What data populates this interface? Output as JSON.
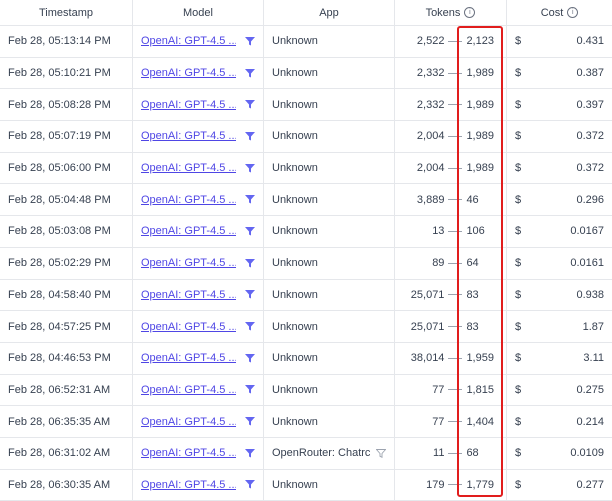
{
  "headers": {
    "timestamp": "Timestamp",
    "model": "Model",
    "app": "App",
    "tokens": "Tokens",
    "cost": "Cost"
  },
  "rows": [
    {
      "timestamp": "Feb 28, 05:13:14 PM",
      "model": "OpenAI: GPT-4.5 ...",
      "app": "Unknown",
      "tokens_in": "2,522",
      "tokens_out": "2,123",
      "currency": "$",
      "cost": "0.431"
    },
    {
      "timestamp": "Feb 28, 05:10:21 PM",
      "model": "OpenAI: GPT-4.5 ...",
      "app": "Unknown",
      "tokens_in": "2,332",
      "tokens_out": "1,989",
      "currency": "$",
      "cost": "0.387"
    },
    {
      "timestamp": "Feb 28, 05:08:28 PM",
      "model": "OpenAI: GPT-4.5 ...",
      "app": "Unknown",
      "tokens_in": "2,332",
      "tokens_out": "1,989",
      "currency": "$",
      "cost": "0.397"
    },
    {
      "timestamp": "Feb 28, 05:07:19 PM",
      "model": "OpenAI: GPT-4.5 ...",
      "app": "Unknown",
      "tokens_in": "2,004",
      "tokens_out": "1,989",
      "currency": "$",
      "cost": "0.372"
    },
    {
      "timestamp": "Feb 28, 05:06:00 PM",
      "model": "OpenAI: GPT-4.5 ...",
      "app": "Unknown",
      "tokens_in": "2,004",
      "tokens_out": "1,989",
      "currency": "$",
      "cost": "0.372"
    },
    {
      "timestamp": "Feb 28, 05:04:48 PM",
      "model": "OpenAI: GPT-4.5 ...",
      "app": "Unknown",
      "tokens_in": "3,889",
      "tokens_out": "46",
      "currency": "$",
      "cost": "0.296"
    },
    {
      "timestamp": "Feb 28, 05:03:08 PM",
      "model": "OpenAI: GPT-4.5 ...",
      "app": "Unknown",
      "tokens_in": "13",
      "tokens_out": "106",
      "currency": "$",
      "cost": "0.0167"
    },
    {
      "timestamp": "Feb 28, 05:02:29 PM",
      "model": "OpenAI: GPT-4.5 ...",
      "app": "Unknown",
      "tokens_in": "89",
      "tokens_out": "64",
      "currency": "$",
      "cost": "0.0161"
    },
    {
      "timestamp": "Feb 28, 04:58:40 PM",
      "model": "OpenAI: GPT-4.5 ...",
      "app": "Unknown",
      "tokens_in": "25,071",
      "tokens_out": "83",
      "currency": "$",
      "cost": "0.938"
    },
    {
      "timestamp": "Feb 28, 04:57:25 PM",
      "model": "OpenAI: GPT-4.5 ...",
      "app": "Unknown",
      "tokens_in": "25,071",
      "tokens_out": "83",
      "currency": "$",
      "cost": "1.87"
    },
    {
      "timestamp": "Feb 28, 04:46:53 PM",
      "model": "OpenAI: GPT-4.5 ...",
      "app": "Unknown",
      "tokens_in": "38,014",
      "tokens_out": "1,959",
      "currency": "$",
      "cost": "3.11"
    },
    {
      "timestamp": "Feb 28, 06:52:31 AM",
      "model": "OpenAI: GPT-4.5 ...",
      "app": "Unknown",
      "tokens_in": "77",
      "tokens_out": "1,815",
      "currency": "$",
      "cost": "0.275"
    },
    {
      "timestamp": "Feb 28, 06:35:35 AM",
      "model": "OpenAI: GPT-4.5 ...",
      "app": "Unknown",
      "tokens_in": "77",
      "tokens_out": "1,404",
      "currency": "$",
      "cost": "0.214"
    },
    {
      "timestamp": "Feb 28, 06:31:02 AM",
      "model": "OpenAI: GPT-4.5 ...",
      "app": "OpenRouter: Chatrc",
      "app_filter": true,
      "tokens_in": "11",
      "tokens_out": "68",
      "currency": "$",
      "cost": "0.0109"
    },
    {
      "timestamp": "Feb 28, 06:30:35 AM",
      "model": "OpenAI: GPT-4.5 ...",
      "app": "Unknown",
      "tokens_in": "179",
      "tokens_out": "1,779",
      "currency": "$",
      "cost": "0.277"
    }
  ],
  "icons": {
    "filter": "filter-icon",
    "info": "info-icon"
  },
  "colors": {
    "link": "#4f46e5",
    "filter_icon": "#6366f1",
    "app_filter_icon": "#9ca3af",
    "highlight": "#e11d1d",
    "border": "#e5e7eb"
  }
}
